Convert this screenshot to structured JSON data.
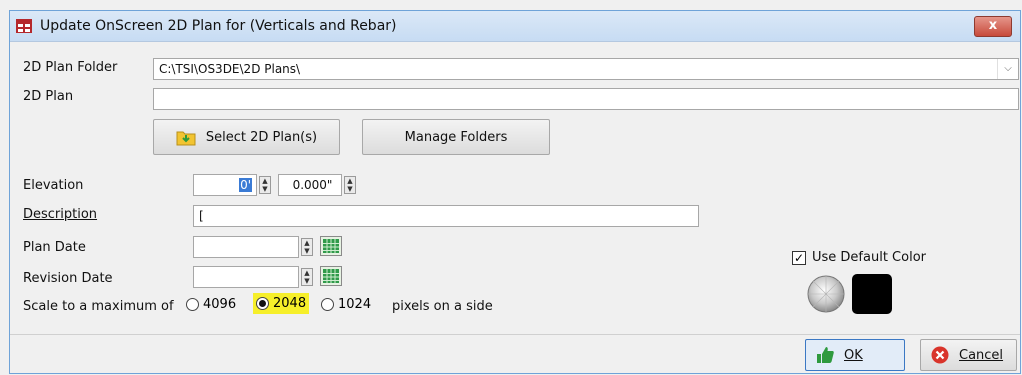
{
  "window": {
    "title": "Update OnScreen 2D Plan for (Verticals and Rebar)",
    "close_label": "x"
  },
  "plan_folder": {
    "label": "2D Plan Folder",
    "value": "C:\\TSI\\OS3DE\\2D Plans\\"
  },
  "plan": {
    "label": "2D Plan",
    "value": ""
  },
  "buttons": {
    "select_plans": "Select 2D Plan(s)",
    "manage_folders": "Manage Folders",
    "ok": "OK",
    "cancel": "Cancel"
  },
  "elevation": {
    "label": "Elevation",
    "feet": "0'",
    "inches": "0.000\""
  },
  "description": {
    "label": "Description",
    "value": "["
  },
  "plan_date": {
    "label": "Plan Date",
    "value": ""
  },
  "revision_date": {
    "label": "Revision Date",
    "value": ""
  },
  "scale": {
    "label": "Scale to a maximum of",
    "options": [
      "4096",
      "2048",
      "1024"
    ],
    "selected": "2048",
    "suffix": "pixels on a side"
  },
  "color": {
    "use_default_label": "Use Default Color",
    "use_default_checked": true,
    "primary": "#000000"
  },
  "colors": {
    "highlight": "#f6ef2a",
    "title_bar": "#d3e3f6",
    "ok_thumb": "#2e9a3e",
    "cancel_icon": "#d9342b"
  }
}
